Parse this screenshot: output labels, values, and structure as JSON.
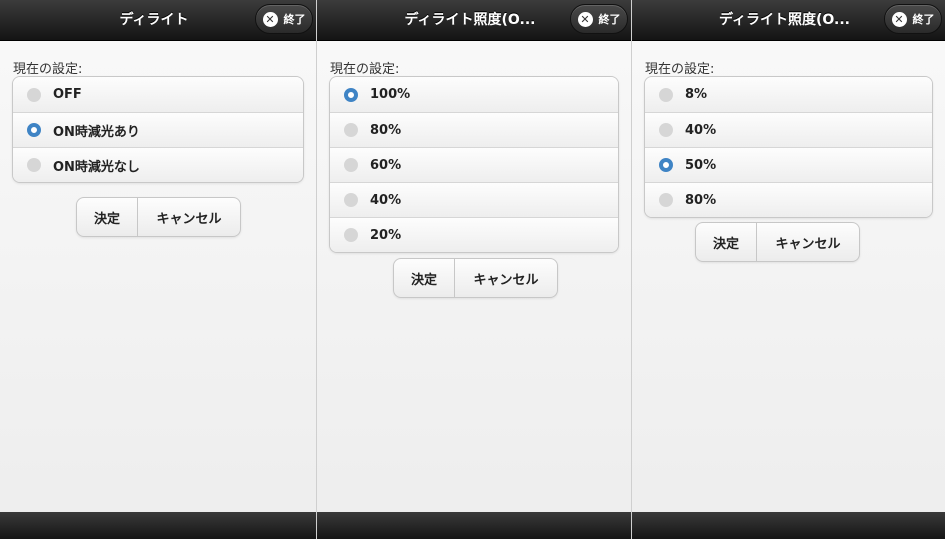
{
  "panels": [
    {
      "title": "ディライト",
      "close_label": "終了",
      "current_label": "現在の設定:",
      "options": [
        {
          "label": "OFF",
          "selected": false
        },
        {
          "label": "ON時減光あり",
          "selected": true
        },
        {
          "label": "ON時減光なし",
          "selected": false
        }
      ],
      "ok_label": "決定",
      "cancel_label": "キャンセル"
    },
    {
      "title": "ディライト照度(O...",
      "close_label": "終了",
      "current_label": "現在の設定:",
      "options": [
        {
          "label": "100%",
          "selected": true
        },
        {
          "label": "80%",
          "selected": false
        },
        {
          "label": "60%",
          "selected": false
        },
        {
          "label": "40%",
          "selected": false
        },
        {
          "label": "20%",
          "selected": false
        }
      ],
      "ok_label": "決定",
      "cancel_label": "キャンセル"
    },
    {
      "title": "ディライト照度(O...",
      "close_label": "終了",
      "current_label": "現在の設定:",
      "options": [
        {
          "label": "8%",
          "selected": false
        },
        {
          "label": "40%",
          "selected": false
        },
        {
          "label": "50%",
          "selected": true
        },
        {
          "label": "80%",
          "selected": false
        }
      ],
      "ok_label": "決定",
      "cancel_label": "キャンセル"
    }
  ],
  "colors": {
    "accent": "#3f84c5",
    "header": "#1e1e1e"
  },
  "icons": {
    "close": "close-icon",
    "radio_on": "radio-selected-icon",
    "radio_off": "radio-unselected-icon"
  }
}
